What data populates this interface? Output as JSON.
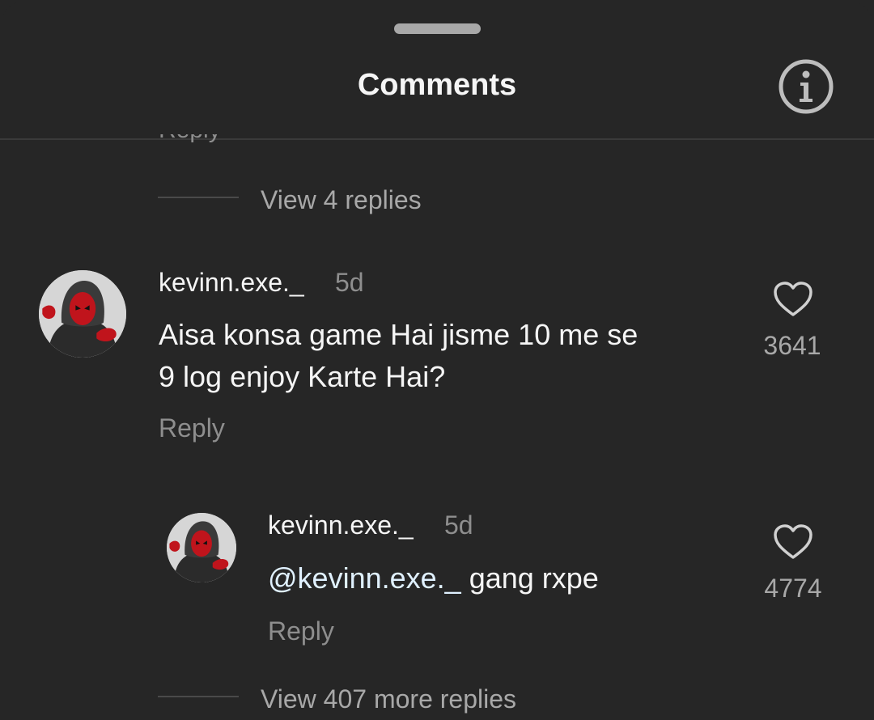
{
  "header": {
    "title": "Comments"
  },
  "top_thread": {
    "clipped_reply_label": "Reply",
    "view_replies_label": "View 4 replies"
  },
  "comment": {
    "username": "kevinn.exe._",
    "time": "5d",
    "text_line1": "Aisa konsa game Hai jisme 10 me se",
    "text_line2": "9 log enjoy Karte Hai?",
    "reply_label": "Reply",
    "likes": "3641"
  },
  "reply": {
    "username": "kevinn.exe._",
    "time": "5d",
    "mention": "@kevinn.exe._",
    "text": " gang rxpe",
    "reply_label": "Reply",
    "likes": "4774"
  },
  "bottom_thread": {
    "view_more_label": "View 407 more replies"
  },
  "icons": {
    "info": "info-icon",
    "heart": "heart-outline-icon",
    "avatar": "deadpool-hooded-avatar"
  },
  "colors": {
    "background": "#262626",
    "primary_text": "#f5f5f5",
    "secondary_text": "#8e8e8e",
    "mention": "#e0f1ff"
  }
}
